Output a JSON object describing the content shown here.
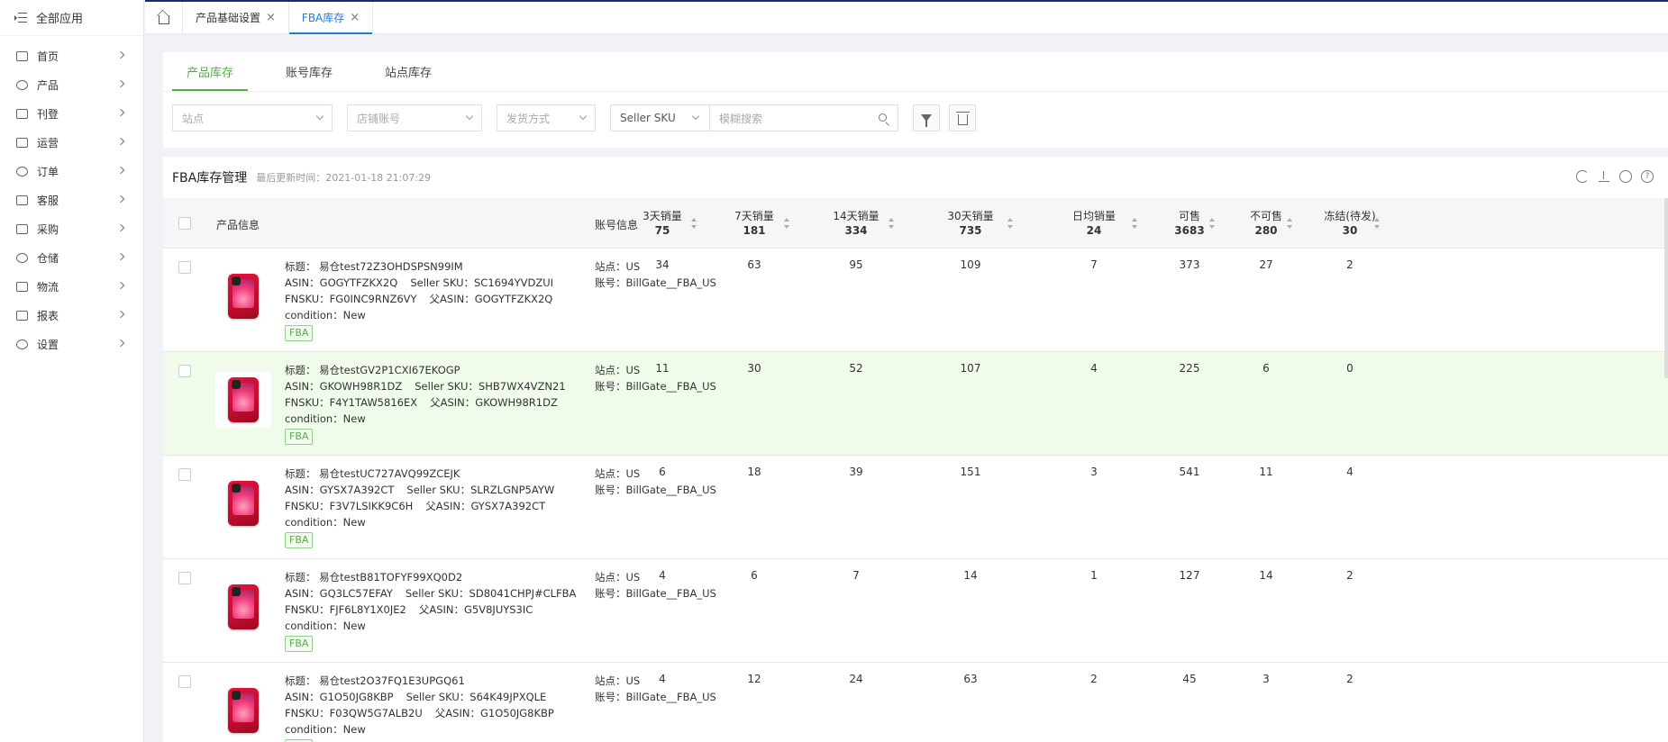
{
  "sidebar": {
    "title": "全部应用",
    "items": [
      {
        "label": "首页",
        "icon": "home-icon"
      },
      {
        "label": "产品",
        "icon": "box-icon"
      },
      {
        "label": "刊登",
        "icon": "publish-icon"
      },
      {
        "label": "运营",
        "icon": "chat-icon"
      },
      {
        "label": "订单",
        "icon": "document-icon"
      },
      {
        "label": "客服",
        "icon": "headset-icon"
      },
      {
        "label": "采购",
        "icon": "shop-icon"
      },
      {
        "label": "仓储",
        "icon": "warehouse-icon"
      },
      {
        "label": "物流",
        "icon": "truck-icon"
      },
      {
        "label": "报表",
        "icon": "report-icon"
      },
      {
        "label": "设置",
        "icon": "gear-icon"
      }
    ]
  },
  "tabs": [
    {
      "label": "产品基础设置",
      "active": false
    },
    {
      "label": "FBA库存",
      "active": true
    }
  ],
  "subtabs": [
    {
      "label": "产品库存",
      "active": true
    },
    {
      "label": "账号库存",
      "active": false
    },
    {
      "label": "站点库存",
      "active": false
    }
  ],
  "filters": {
    "site_placeholder": "站点",
    "store_placeholder": "店铺账号",
    "ship_placeholder": "发货方式",
    "search_field": "Seller SKU",
    "search_placeholder": "模糊搜索"
  },
  "panel": {
    "title": "FBA库存管理",
    "updated": "最后更新时间：2021-01-18 21:07:29"
  },
  "columns": {
    "product": "产品信息",
    "account": "账号信息",
    "metrics": [
      {
        "label": "3天销量",
        "total": "75"
      },
      {
        "label": "7天销量",
        "total": "181"
      },
      {
        "label": "14天销量",
        "total": "334"
      },
      {
        "label": "30天销量",
        "total": "735"
      },
      {
        "label": "日均销量",
        "total": "24"
      },
      {
        "label": "可售",
        "total": "3683"
      },
      {
        "label": "不可售",
        "total": "280"
      },
      {
        "label": "冻结(待发)",
        "total": "30"
      }
    ]
  },
  "labels": {
    "title": "标题：",
    "asin": "ASIN：",
    "seller_sku": "Seller SKU：",
    "fnsku": "FNSKU：",
    "parent_asin": "父ASIN：",
    "condition": "condition：",
    "site": "站点：",
    "account": "账号："
  },
  "rows": [
    {
      "title": "易仓test72Z3OHDSPSN99IM",
      "asin": "GOGYTFZKX2Q",
      "sku": "SC1694YVDZUI",
      "fnsku": "FG0INC9RNZ6VY",
      "parent": "GOGYTFZKX2Q",
      "condition": "New",
      "badge": "FBA",
      "site": "US",
      "account": "BillGate__FBA_US",
      "values": [
        "34",
        "63",
        "95",
        "109",
        "7",
        "373",
        "27",
        "2"
      ]
    },
    {
      "title": "易仓testGV2P1CXI67EKOGP",
      "asin": "GKOWH98R1DZ",
      "sku": "SHB7WX4VZN21",
      "fnsku": "F4Y1TAW5816EX",
      "parent": "GKOWH98R1DZ",
      "condition": "New",
      "badge": "FBA",
      "site": "US",
      "account": "BillGate__FBA_US",
      "values": [
        "11",
        "30",
        "52",
        "107",
        "4",
        "225",
        "6",
        "0"
      ]
    },
    {
      "title": "易仓testUC727AVQ99ZCEJK",
      "asin": "GYSX7A392CT",
      "sku": "SLRZLGNP5AYW",
      "fnsku": "F3V7LSIKK9C6H",
      "parent": "GYSX7A392CT",
      "condition": "New",
      "badge": "FBA",
      "site": "US",
      "account": "BillGate__FBA_US",
      "values": [
        "6",
        "18",
        "39",
        "151",
        "3",
        "541",
        "11",
        "4"
      ]
    },
    {
      "title": "易仓testB81TOFYF99XQ0D2",
      "asin": "GQ3LC57EFAY",
      "sku": "SD8041CHPJ#CLFBA",
      "fnsku": "FJF6L8Y1X0JE2",
      "parent": "G5V8JUYS3IC",
      "condition": "New",
      "badge": "FBA",
      "site": "US",
      "account": "BillGate__FBA_US",
      "values": [
        "4",
        "6",
        "7",
        "14",
        "1",
        "127",
        "14",
        "2"
      ]
    },
    {
      "title": "易仓test2O37FQ1E3UPGQ61",
      "asin": "G1O50JG8KBP",
      "sku": "S64K49JPXQLE",
      "fnsku": "F03QW5G7ALB2U",
      "parent": "G1O50JG8KBP",
      "condition": "New",
      "badge": "FBA",
      "site": "US",
      "account": "BillGate__FBA_US",
      "values": [
        "4",
        "12",
        "24",
        "63",
        "2",
        "45",
        "3",
        "2"
      ]
    }
  ]
}
